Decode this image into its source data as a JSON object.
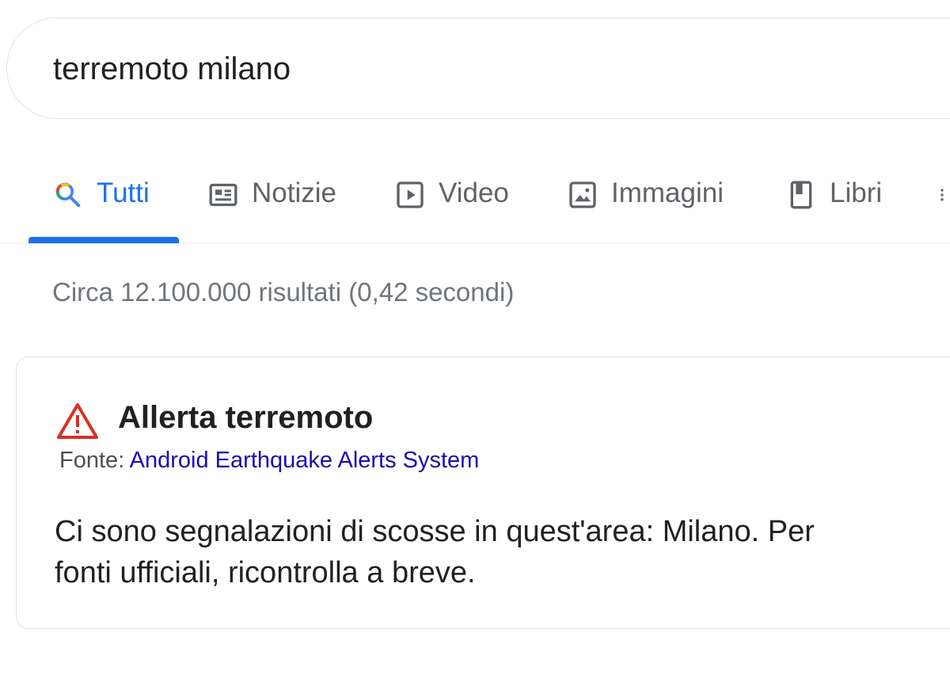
{
  "search": {
    "query": "terremoto milano"
  },
  "tabs": [
    {
      "label": "Tutti",
      "icon": "search-icon",
      "active": true
    },
    {
      "label": "Notizie",
      "icon": "news-icon",
      "active": false
    },
    {
      "label": "Video",
      "icon": "video-play-icon",
      "active": false
    },
    {
      "label": "Immagini",
      "icon": "image-icon",
      "active": false
    },
    {
      "label": "Libri",
      "icon": "book-icon",
      "active": false
    }
  ],
  "more_menu_icon": "more-vert-icon",
  "result_stats": "Circa 12.100.000 risultati (0,42 secondi)",
  "alert": {
    "icon": "warning-triangle-icon",
    "title": "Allerta terremoto",
    "source_prefix": "Fonte: ",
    "source_name": "Android Earthquake Alerts System",
    "body_line1": "Ci sono segnalazioni di scosse in quest'area: Milano. Per",
    "body_line2": "fonti ufficiali, ricontrolla a breve."
  },
  "colors": {
    "accent": "#1a73e8",
    "link": "#1a0dab",
    "warning": "#d93025",
    "muted_text": "#70757a"
  }
}
